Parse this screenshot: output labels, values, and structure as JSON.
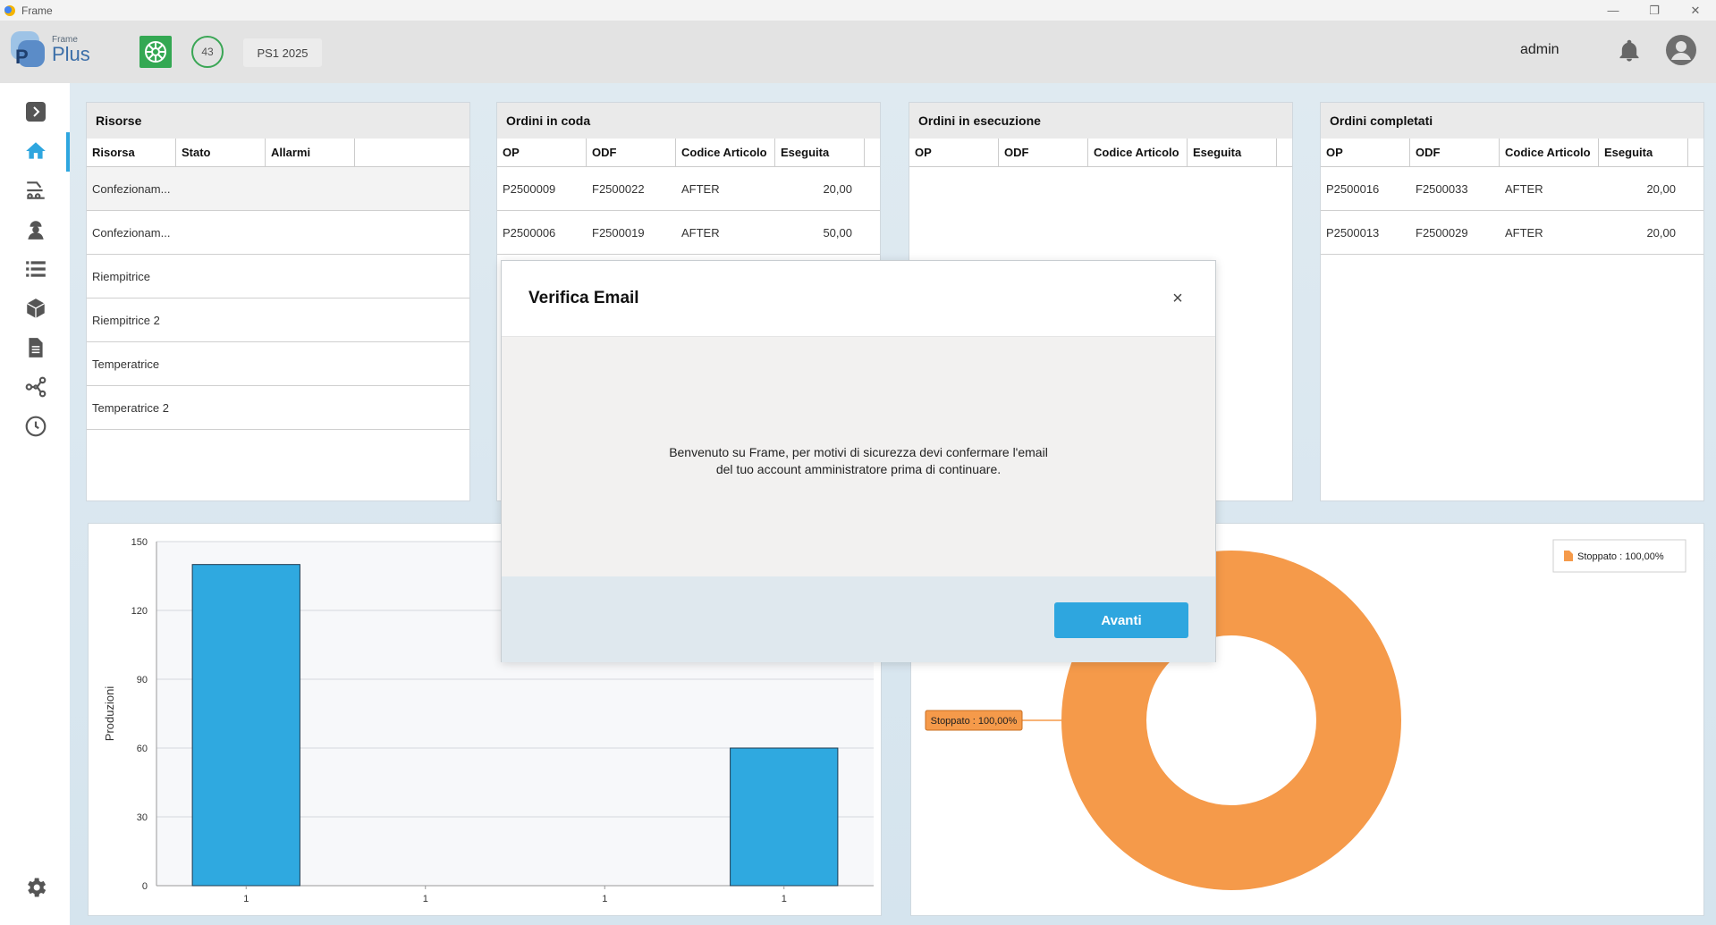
{
  "window": {
    "title": "Frame",
    "minimize": "—",
    "restore": "❐",
    "close": "✕"
  },
  "header": {
    "logo_small": "Frame",
    "logo_big": "Plus",
    "logo_letter": "P",
    "badge_count": "43",
    "period_chip": "PS1 2025",
    "user": "admin"
  },
  "panels": {
    "risorse": {
      "title": "Risorse",
      "columns": [
        "Risorsa",
        "Stato",
        "Allarmi"
      ],
      "rows": [
        [
          "Confezionam...",
          "",
          ""
        ],
        [
          "Confezionam...",
          "",
          ""
        ],
        [
          "Riempitrice",
          "",
          ""
        ],
        [
          "Riempitrice 2",
          "",
          ""
        ],
        [
          "Temperatrice",
          "",
          ""
        ],
        [
          "Temperatrice 2",
          "",
          ""
        ]
      ]
    },
    "coda": {
      "title": "Ordini in coda",
      "columns": [
        "OP",
        "ODF",
        "Codice Articolo",
        "Eseguita"
      ],
      "rows": [
        [
          "P2500009",
          "F2500022",
          "AFTER",
          "20,00"
        ],
        [
          "P2500006",
          "F2500019",
          "AFTER",
          "50,00"
        ]
      ]
    },
    "esecuzione": {
      "title": "Ordini in esecuzione",
      "columns": [
        "OP",
        "ODF",
        "Codice Articolo",
        "Eseguita"
      ],
      "rows": []
    },
    "completati": {
      "title": "Ordini completati",
      "columns": [
        "OP",
        "ODF",
        "Codice Articolo",
        "Eseguita"
      ],
      "rows": [
        [
          "P2500016",
          "F2500033",
          "AFTER",
          "20,00"
        ],
        [
          "P2500013",
          "F2500029",
          "AFTER",
          "20,00"
        ]
      ]
    }
  },
  "modal": {
    "title": "Verifica Email",
    "close": "×",
    "message_line1": "Benvenuto su Frame, per motivi di sicurezza devi confermare l'email",
    "message_line2": "del tuo account amministratore prima di continuare.",
    "button": "Avanti"
  },
  "chart_data": [
    {
      "type": "bar",
      "categories": [
        "1",
        "1",
        "1",
        "1"
      ],
      "values": [
        140,
        0,
        0,
        60
      ],
      "ylabel": "Produzioni",
      "ylim": [
        0,
        150
      ],
      "yticks": [
        0,
        30,
        60,
        90,
        120,
        150
      ],
      "color": "#2fa9e0",
      "grid": true
    },
    {
      "type": "pie",
      "donut": true,
      "slices": [
        {
          "label": "Stoppato : 100,00%",
          "value": 100
        }
      ],
      "legend": "top-right",
      "color": "#f59a4a"
    }
  ]
}
